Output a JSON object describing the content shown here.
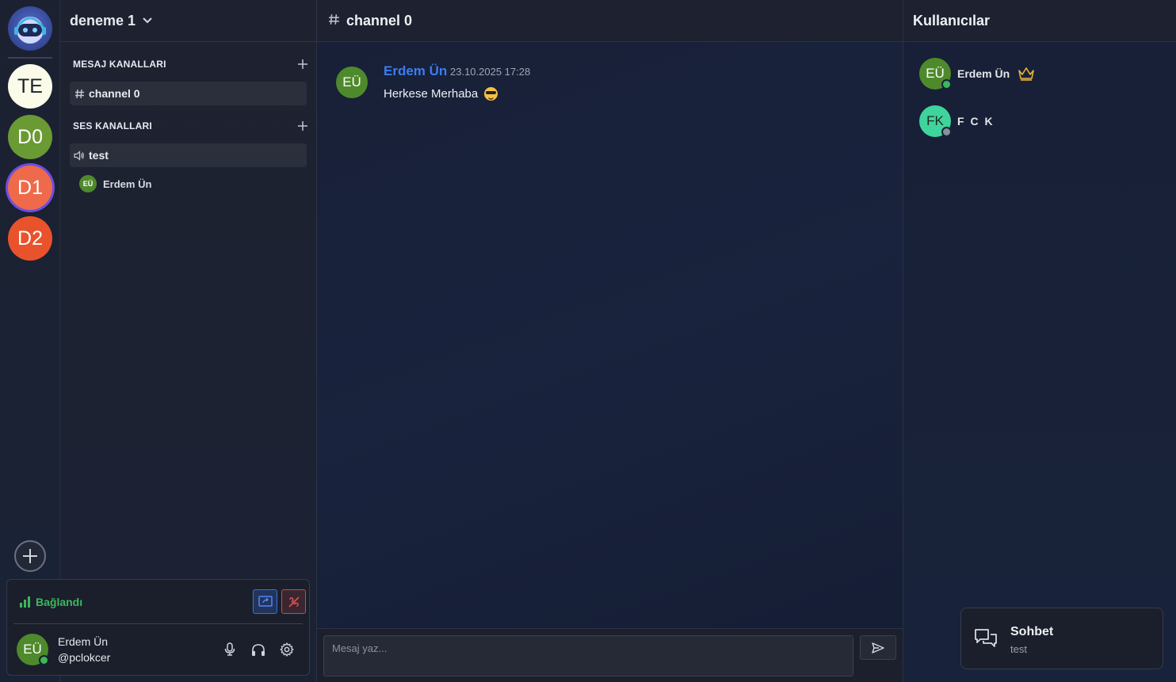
{
  "servers": {
    "items": [
      {
        "label": "TE"
      },
      {
        "label": "D0"
      },
      {
        "label": "D1"
      },
      {
        "label": "D2"
      }
    ],
    "active_index": 2
  },
  "server": {
    "name": "deneme 1"
  },
  "categories": {
    "text": {
      "label": "MESAJ KANALLARI"
    },
    "voice": {
      "label": "SES KANALLARI"
    }
  },
  "channels": {
    "text": [
      {
        "name": "channel 0"
      }
    ],
    "voice": [
      {
        "name": "test",
        "users": [
          {
            "initials": "EÜ",
            "name": "Erdem Ün"
          }
        ]
      }
    ]
  },
  "voice_connection": {
    "status": "Bağlandı"
  },
  "current_user": {
    "initials": "EÜ",
    "name": "Erdem Ün",
    "handle": "@pclokcer",
    "status": "online"
  },
  "chat": {
    "channel_name": "channel 0",
    "messages": [
      {
        "initials": "EÜ",
        "author": "Erdem Ün",
        "time": "23.10.2025 17:28",
        "text": "Herkese Merhaba"
      }
    ],
    "composer_placeholder": "Mesaj yaz..."
  },
  "members": {
    "title": "Kullanıcılar",
    "list": [
      {
        "initials": "EÜ",
        "name": "Erdem Ün",
        "status": "online",
        "owner": true
      },
      {
        "initials": "FK",
        "name": "F C K",
        "status": "offline",
        "owner": false
      }
    ]
  },
  "toast": {
    "title": "Sohbet",
    "subtitle": "test"
  },
  "colors": {
    "accent": "#3d7cf0",
    "online": "#3bb85a",
    "offline": "#8a8f9a",
    "danger": "#d64545"
  }
}
